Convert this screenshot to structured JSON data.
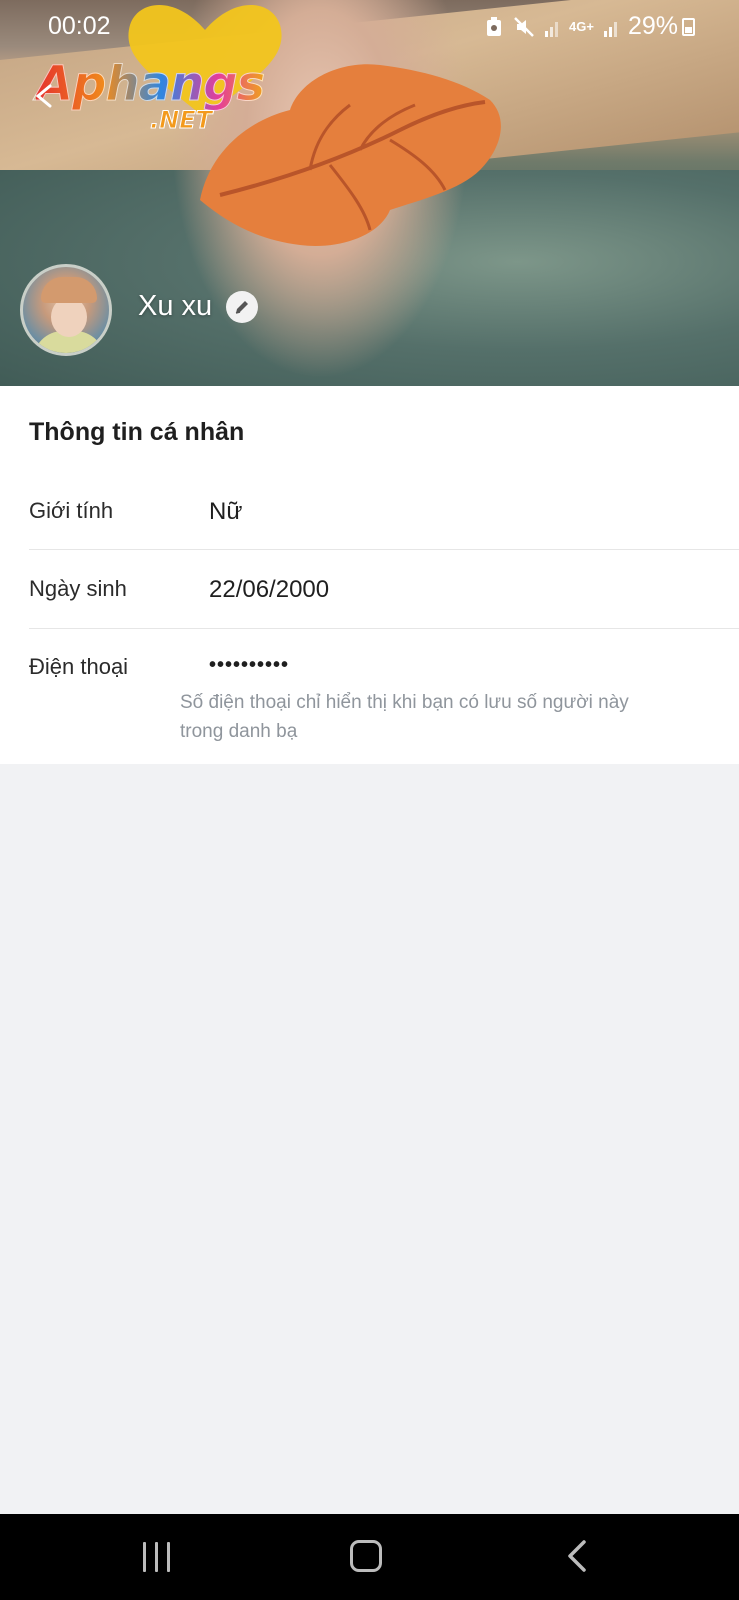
{
  "status_bar": {
    "time": "00:02",
    "network": "4G+",
    "battery": "29%",
    "icons": [
      "screenshot-icon",
      "mute-icon",
      "signal-icon",
      "signal-icon",
      "battery-icon"
    ]
  },
  "watermark": {
    "brand": "Aphangs",
    "suffix": ".NET"
  },
  "profile": {
    "name": "Xu xu"
  },
  "personal_info": {
    "title": "Thông tin cá nhân",
    "gender_label": "Giới tính",
    "gender_value": "Nữ",
    "birthday_label": "Ngày sinh",
    "birthday_value": "22/06/2000",
    "phone_label": "Điện thoại",
    "phone_value": "••••••••••",
    "phone_note": "Số điện thoại chỉ hiển thị khi bạn có lưu số người này trong danh bạ"
  },
  "colors": {
    "page_background": "#f1f2f4",
    "card_background": "#ffffff",
    "note_text": "#8f959c",
    "leaf_orange": "#e57f3d",
    "heart_yellow": "#f2c51c",
    "navbar": "#000000"
  }
}
